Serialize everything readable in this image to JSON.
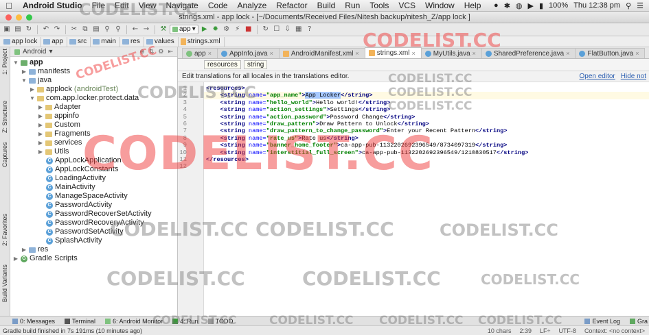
{
  "menubar": {
    "app_name": "Android Studio",
    "items": [
      "File",
      "Edit",
      "View",
      "Navigate",
      "Code",
      "Analyze",
      "Refactor",
      "Build",
      "Run",
      "Tools",
      "VCS",
      "Window",
      "Help"
    ],
    "battery": "100%",
    "clock": "Thu 12:38 pm"
  },
  "window": {
    "title": "strings.xml - app lock - [~/Documents/Received Files/Nitesh backup/nitesh_Z/app lock ]"
  },
  "toolbar": {
    "run_config": "app"
  },
  "breadcrumbs": [
    "app lock",
    "app",
    "src",
    "main",
    "res",
    "values",
    "strings.xml"
  ],
  "side_tabs": {
    "project": "1: Project",
    "structure": "Z: Structure",
    "captures": "Captures",
    "favorites": "2: Favorites",
    "build_variants": "Build Variants"
  },
  "project_panel": {
    "view_mode": "Android",
    "tree": [
      {
        "label": "app"
      },
      {
        "label": "manifests"
      },
      {
        "label": "java"
      },
      {
        "label": "applock",
        "suffix": "(androidTest)"
      },
      {
        "label": "com.app.locker.protect.data"
      },
      {
        "label": "Adapter"
      },
      {
        "label": "appinfo"
      },
      {
        "label": "Custom"
      },
      {
        "label": "Fragments"
      },
      {
        "label": "services"
      },
      {
        "label": "Utils"
      },
      {
        "label": "AppLockApplication"
      },
      {
        "label": "AppLockConstants"
      },
      {
        "label": "LoadingActivity"
      },
      {
        "label": "MainActivity"
      },
      {
        "label": "ManageSpaceActivity"
      },
      {
        "label": "PasswordActivity"
      },
      {
        "label": "PasswordRecoverSetActivity"
      },
      {
        "label": "PasswordRecoveryActivity"
      },
      {
        "label": "PasswordSetActivity"
      },
      {
        "label": "SplashActivity"
      },
      {
        "label": "res"
      },
      {
        "label": "Gradle Scripts"
      }
    ]
  },
  "editor_tabs": [
    "app",
    "AppInfo.java",
    "AndroidManifest.xml",
    "strings.xml",
    "MyUtils.java",
    "SharedPreference.java",
    "FlatButton.java"
  ],
  "sub_tabs": [
    "resources",
    "string"
  ],
  "banner": {
    "text": "Edit translations for all locales in the translations editor.",
    "open_editor": "Open editor",
    "hide": "Hide not"
  },
  "line_numbers": [
    "1",
    "2",
    "3",
    "4",
    "5",
    "6",
    "7",
    "8",
    "9",
    "10",
    "11",
    "12"
  ],
  "code": {
    "open_root": "resources",
    "close_root": "</resources>",
    "entries": [
      {
        "name": "app_name",
        "value": "App Locker"
      },
      {
        "name": "hello_world",
        "value": "Hello world!"
      },
      {
        "name": "action_settings",
        "value": "Settings"
      },
      {
        "name": "action_password",
        "value": "Password Change"
      },
      {
        "name": "draw_pattern",
        "value": "Draw Pattern to Unlock"
      },
      {
        "name": "draw_pattern_to_change_password",
        "value": "Enter your Recent Pattern"
      },
      {
        "name": "rate_us",
        "value": "Rate us"
      },
      {
        "name": "banner_home_footer",
        "value": "ca-app-pub-1132202692396549/8734097319"
      },
      {
        "name": "interstitial_full_screen",
        "value": "ca-app-pub-1132202692396549/1210830517"
      }
    ]
  },
  "bottom_tools": {
    "messages": "0: Messages",
    "terminal": "Terminal",
    "android_monitor": "6: Android Monitor",
    "run": "4: Run",
    "todo": "TODO",
    "event_log": "Event Log",
    "gradle": "Gra"
  },
  "status": {
    "message": "Gradle build finished in 7s 191ms (10 minutes ago)",
    "chars": "10 chars",
    "position": "2:39",
    "line_ending": "LF÷",
    "encoding": "UTF-8",
    "context": "Context: <no context>"
  },
  "watermark": "CODELIST.CC"
}
